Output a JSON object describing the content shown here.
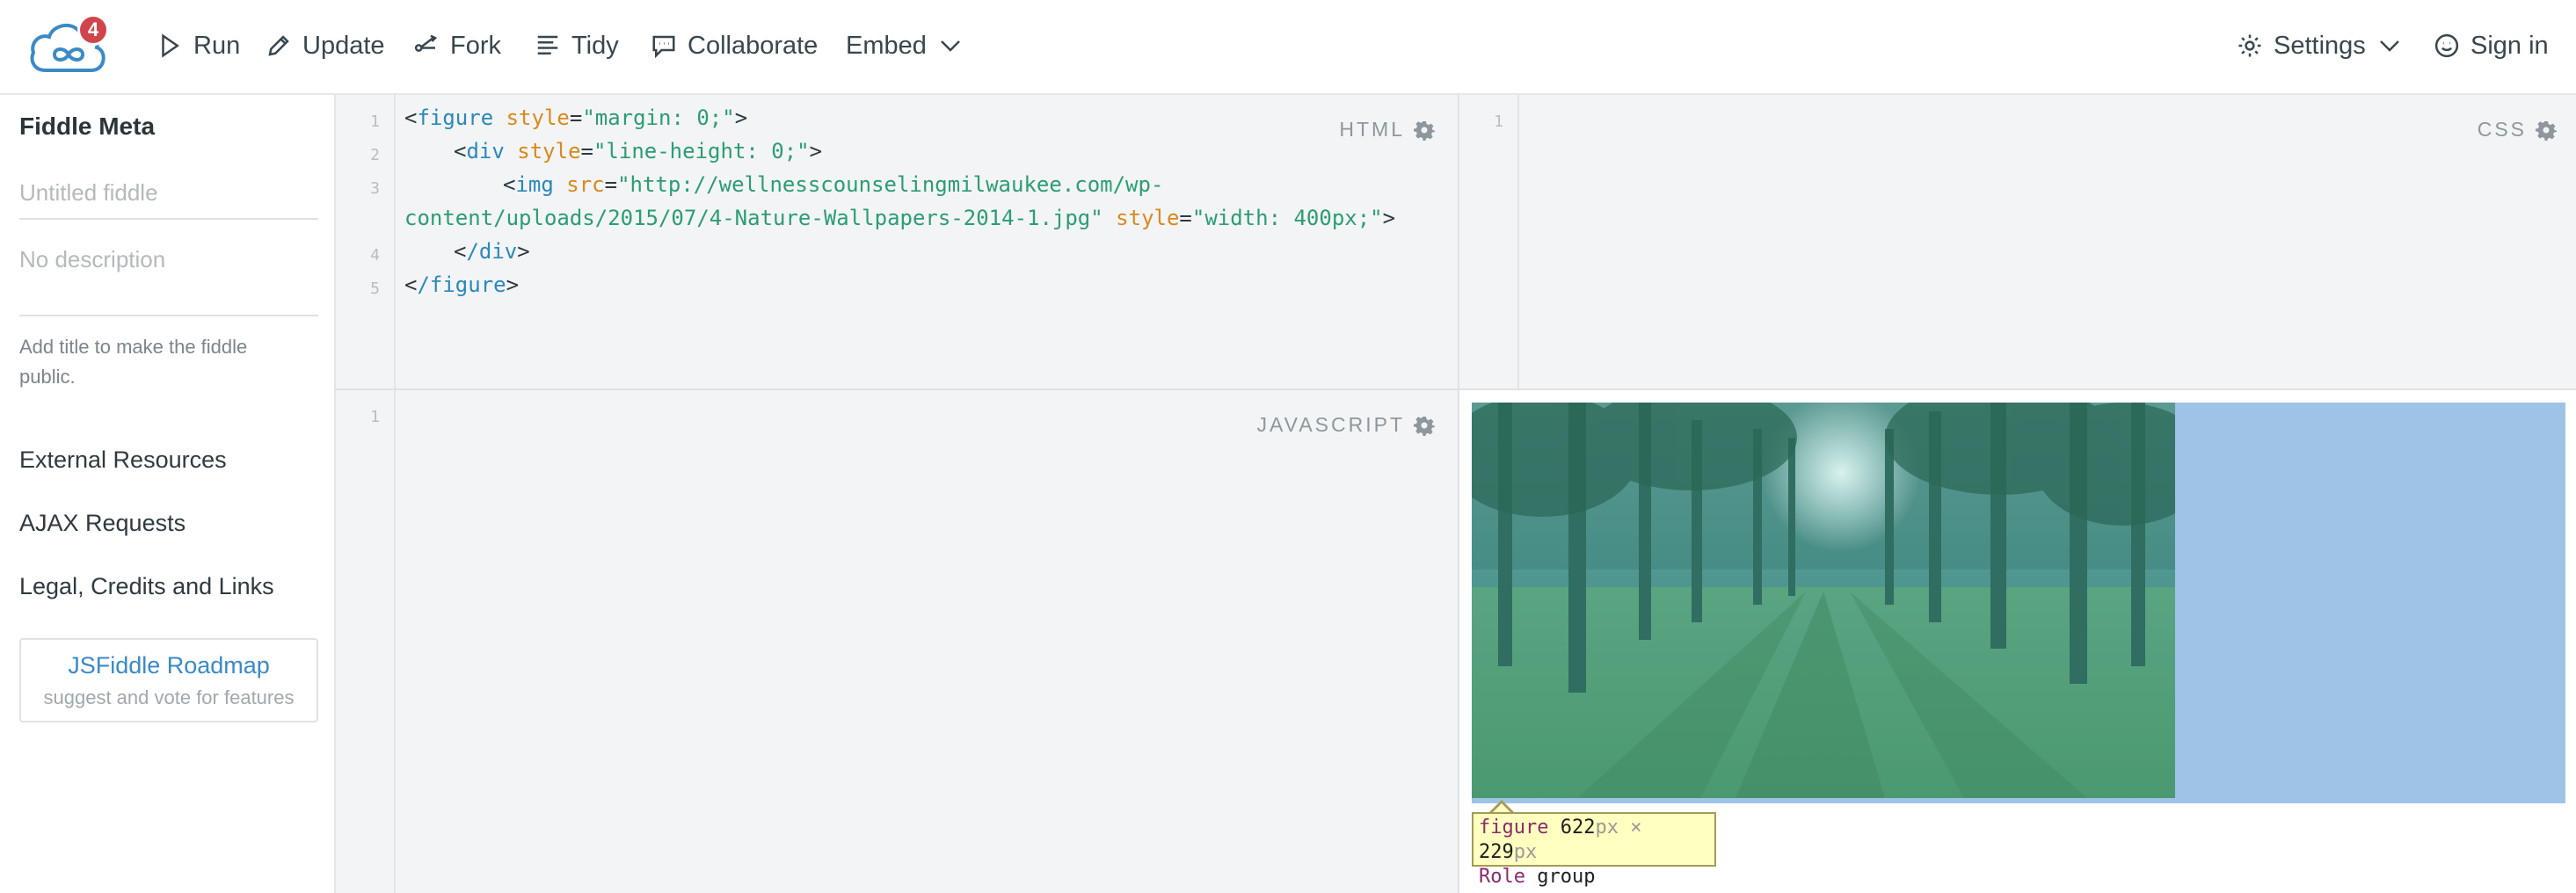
{
  "header": {
    "badge_count": "4",
    "run": "Run",
    "update": "Update",
    "fork": "Fork",
    "tidy": "Tidy",
    "collaborate": "Collaborate",
    "embed": "Embed",
    "settings": "Settings",
    "sign_in": "Sign in"
  },
  "sidebar": {
    "title": "Fiddle Meta",
    "title_placeholder": "Untitled fiddle",
    "description_placeholder": "No description",
    "note": "Add title to make the fiddle public.",
    "links": [
      "External Resources",
      "AJAX Requests",
      "Legal, Credits and Links"
    ],
    "roadmap_title": "JSFiddle Roadmap",
    "roadmap_sub": "suggest and vote for features"
  },
  "panels": {
    "html_label": "HTML",
    "css_label": "CSS",
    "js_label": "JAVASCRIPT"
  },
  "html_code": {
    "line_numbers": [
      "1",
      "2",
      "3",
      "4",
      "5"
    ],
    "l1_tag": "figure",
    "l1_attr": "style",
    "l1_val": "\"margin: 0;\"",
    "l2_tag": "div",
    "l2_attr": "style",
    "l2_val": "\"line-height: 0;\"",
    "l3_tag": "img",
    "l3_attr": "src",
    "l3_val_a": "\"http://wellnesscounselingmilwaukee.com/wp-",
    "l3_val_b": "content/uploads/2015/07/4-Nature-Wallpapers-2014-1.jpg\"",
    "l3_attr2": "style",
    "l3_val2": "\"width: 400px;\"",
    "l4_tag": "/div",
    "l5_tag": "/figure"
  },
  "css_code": {
    "line_numbers": [
      "1"
    ]
  },
  "js_code": {
    "line_numbers": [
      "1"
    ]
  },
  "result": {
    "tooltip_tag": "figure",
    "tooltip_w": "622",
    "tooltip_h": "229",
    "tooltip_unit": "px",
    "tooltip_times": "×",
    "tooltip_role_label": "Role",
    "tooltip_role": "group"
  },
  "colors": {
    "accent": "#3a8ac7",
    "badge": "#d0454c",
    "tag": "#2a88bb",
    "attr": "#d88a1e",
    "value": "#2b9d74",
    "highlight": "#9ec3e6"
  }
}
